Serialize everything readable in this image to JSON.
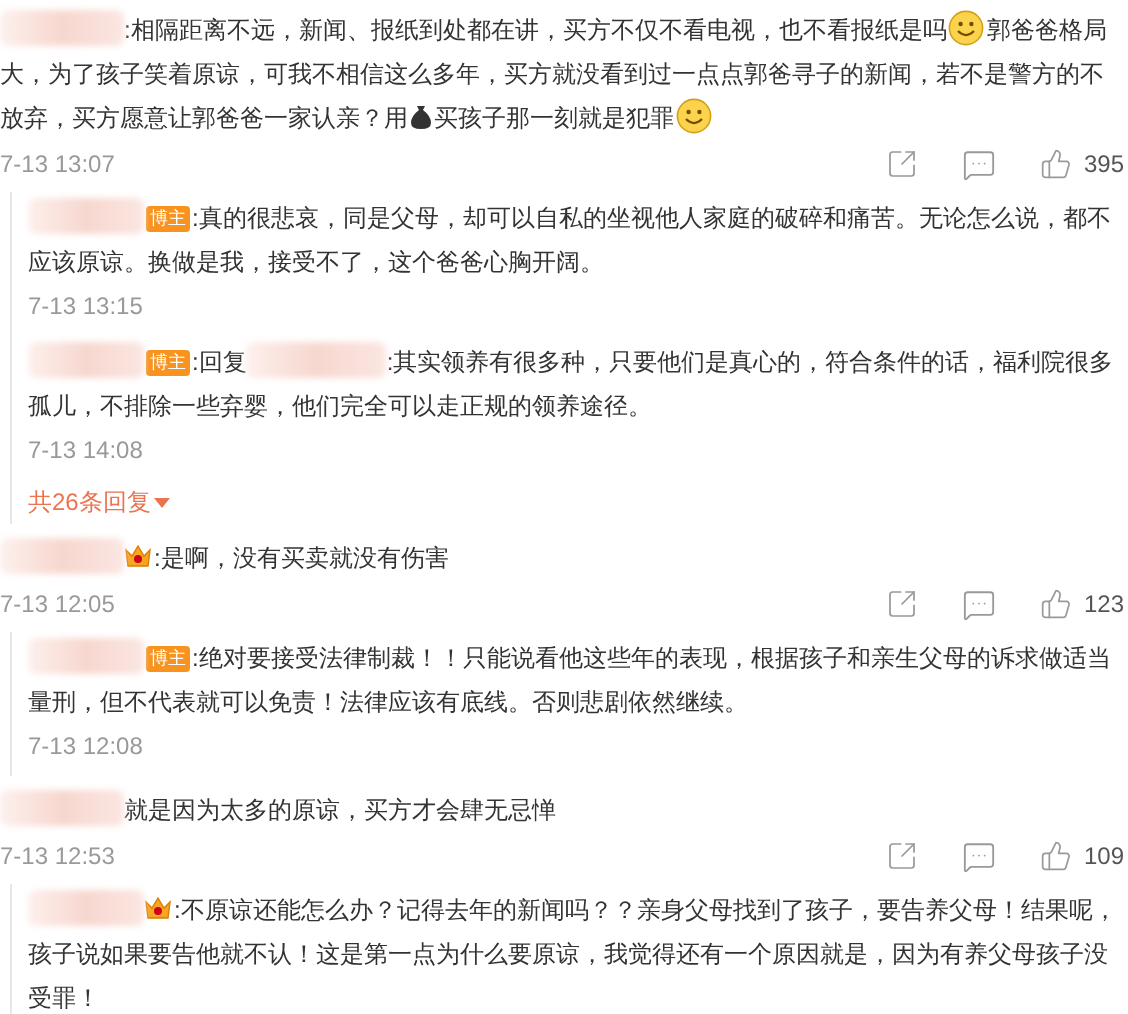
{
  "comments": [
    {
      "content": [
        {
          "kind": "text",
          "text": ":相隔距离不远，新闻、报纸到处都在讲，买方不仅不看电视，也不看报纸是吗"
        },
        {
          "kind": "smiley"
        },
        {
          "kind": "text",
          "text": "郭爸爸格局"
        },
        {
          "kind": "text",
          "text": "大，为了孩子笑着原谅，可我不相信这么多年，买方就没看到过一点点郭爸寻子的新闻，若不是警方的不"
        },
        {
          "kind": "text",
          "text": "放弃，买方愿意让郭爸爸一家认亲？用"
        },
        {
          "kind": "moneybag"
        },
        {
          "kind": "text",
          "text": "买孩子那一刻就是犯罪"
        },
        {
          "kind": "smiley"
        }
      ],
      "time": "7-13 13:07",
      "likes": "395",
      "replies": [
        {
          "badge": {
            "kind": "owner",
            "label": "博主"
          },
          "content": [
            {
              "kind": "text",
              "text": ":真的很悲哀，同是父母，却可以自私的坐视他人家庭的破碎和痛苦。无论怎么说，都不"
            },
            {
              "kind": "text",
              "text": "应该原谅。换做是我，接受不了，这个爸爸心胸开阔。"
            }
          ],
          "time": "7-13 13:15"
        },
        {
          "badge": {
            "kind": "owner",
            "label": "博主"
          },
          "content": [
            {
              "kind": "text",
              "text": ":回复"
            },
            {
              "kind": "hidden_name"
            },
            {
              "kind": "text",
              "text": ":其实领养有很多种，只要他们是真心的，符合条件的话，福利院很多"
            },
            {
              "kind": "text",
              "text": "孤儿，不排除一些弃婴，他们完全可以走正规的领养途径。"
            }
          ],
          "time": "7-13 14:08"
        }
      ],
      "more_replies": "共26条回复"
    },
    {
      "badge": {
        "kind": "vip"
      },
      "content": [
        {
          "kind": "text",
          "text": ":是啊，没有买卖就没有伤害"
        }
      ],
      "time": "7-13 12:05",
      "likes": "123",
      "replies": [
        {
          "badge": {
            "kind": "owner",
            "label": "博主"
          },
          "content": [
            {
              "kind": "text",
              "text": ":绝对要接受法律制裁！！只能说看他这些年的表现，根据孩子和亲生父母的诉求做适当"
            },
            {
              "kind": "text",
              "text": "量刑，但不代表就可以免责！法律应该有底线。否则悲剧依然继续。"
            }
          ],
          "time": "7-13 12:08"
        }
      ]
    },
    {
      "content": [
        {
          "kind": "text",
          "text": "就是因为太多的原谅，买方才会肆无忌惮"
        }
      ],
      "time": "7-13 12:53",
      "likes": "109",
      "replies": [
        {
          "badge": {
            "kind": "vip"
          },
          "content": [
            {
              "kind": "text",
              "text": ":不原谅还能怎么办？记得去年的新闻吗？？亲身父母找到了孩子，要告养父母！结果呢，"
            },
            {
              "kind": "text",
              "text": "孩子说如果要告他就不认！这是第一点为什么要原谅，我觉得还有一个原因就是，因为有养父母孩子没"
            },
            {
              "kind": "text",
              "text": "受罪！"
            }
          ]
        }
      ]
    }
  ]
}
